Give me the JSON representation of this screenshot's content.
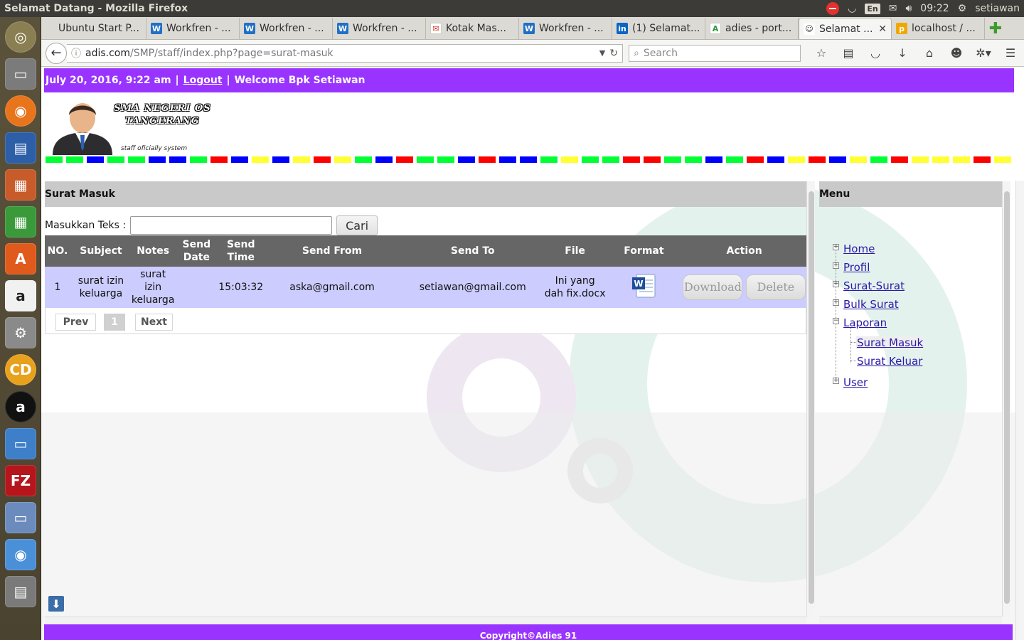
{
  "panel": {
    "window_title": "Selamat Datang - Mozilla Firefox",
    "lang": "En",
    "clock": "09:22",
    "user": "setiawan"
  },
  "tabs": [
    {
      "label": "Ubuntu Start P...",
      "icon": "ubuntu-icon"
    },
    {
      "label": "Workfren - ...",
      "icon": "w-icon"
    },
    {
      "label": "Workfren - ...",
      "icon": "w-icon"
    },
    {
      "label": "Workfren - ...",
      "icon": "w-icon"
    },
    {
      "label": "Kotak Mas...",
      "icon": "gmail-icon"
    },
    {
      "label": "Workfren - ...",
      "icon": "w-icon"
    },
    {
      "label": "(1) Selamat...",
      "icon": "linkedin-icon"
    },
    {
      "label": "adies - port...",
      "icon": "a-icon"
    },
    {
      "label": "Selamat ...",
      "icon": "user-icon",
      "active": true
    },
    {
      "label": "localhost / ...",
      "icon": "pma-icon"
    }
  ],
  "nav": {
    "url_host": "adis.com",
    "url_path": "/SMP/staff/index.php?page=surat-masuk",
    "search_placeholder": "Search"
  },
  "page": {
    "date_text": "July 20, 2016, 9:22 am",
    "sep1": "|",
    "logout": "Logout",
    "sep2": "|",
    "welcome": "Welcome Bpk Setiawan",
    "school_line1": "SMA NEGERI OS",
    "school_line2": "TANGERANG",
    "tagline": "staff oficially system",
    "panel_title": "Surat Masuk",
    "search_label": "Masukkan Teks :",
    "search_button": "Cari",
    "columns": [
      "NO.",
      "Subject",
      "Notes",
      "Send Date",
      "Send Time",
      "Send From",
      "Send To",
      "File",
      "Format",
      "Action"
    ],
    "rows": [
      {
        "no": "1",
        "subject": "surat izin keluarga",
        "notes": "surat izin keluarga",
        "send_date": "",
        "send_time": "15:03:32",
        "send_from": "aska@gmail.com",
        "send_to": "setiawan@gmail.com",
        "file": "Ini yang dah fix.docx",
        "download": "Download",
        "delete": "Delete"
      }
    ],
    "pager": {
      "prev": "Prev",
      "current": "1",
      "next": "Next"
    },
    "menu_title": "Menu",
    "menu": {
      "home": "Home",
      "profil": "Profil",
      "surat_surat": "Surat-Surat",
      "bulk_surat": "Bulk Surat",
      "laporan": "Laporan",
      "surat_masuk": "Surat Masuk",
      "surat_keluar": "Surat Keluar",
      "user": "User"
    },
    "footer": "Copyright©Adies 91"
  },
  "colors": {
    "accent": "#9933ff",
    "header_row": "#666666",
    "data_row": "#ccccff",
    "stripe": [
      "#00ff33",
      "#0000ff",
      "#ffff33",
      "#ff0000"
    ]
  }
}
